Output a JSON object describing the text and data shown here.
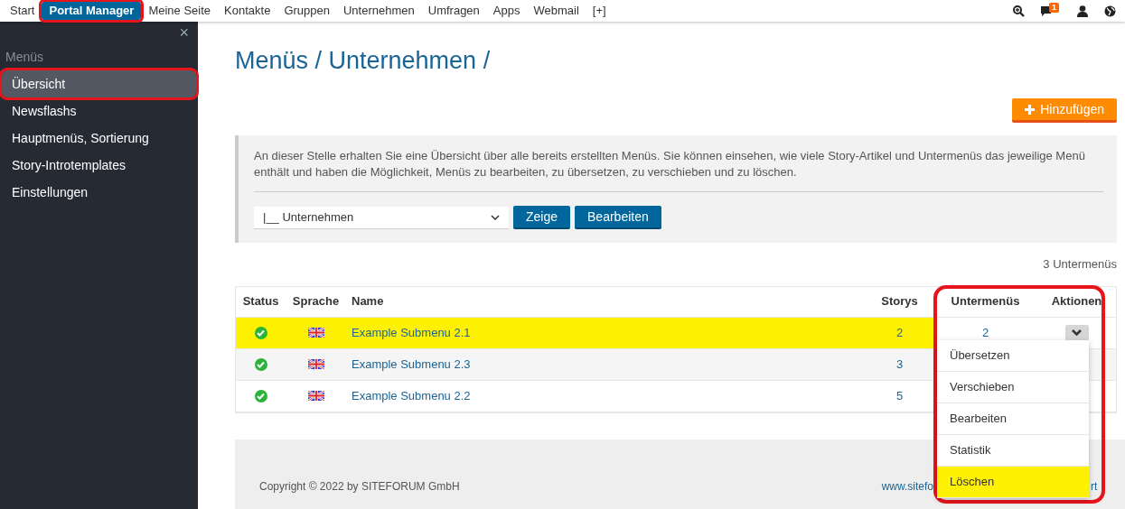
{
  "top_nav": {
    "items": [
      {
        "label": "Start",
        "selected": false,
        "highlighted": false
      },
      {
        "label": "Portal Manager",
        "selected": true,
        "highlighted": true
      },
      {
        "label": "Meine Seite",
        "selected": false,
        "highlighted": false
      },
      {
        "label": "Kontakte",
        "selected": false,
        "highlighted": false
      },
      {
        "label": "Gruppen",
        "selected": false,
        "highlighted": false
      },
      {
        "label": "Unternehmen",
        "selected": false,
        "highlighted": false
      },
      {
        "label": "Umfragen",
        "selected": false,
        "highlighted": false
      },
      {
        "label": "Apps",
        "selected": false,
        "highlighted": false
      },
      {
        "label": "Webmail",
        "selected": false,
        "highlighted": false
      },
      {
        "label": "[+]",
        "selected": false,
        "highlighted": false
      }
    ],
    "message_badge": "1"
  },
  "sidebar": {
    "close": "×",
    "heading": "Menüs",
    "items": [
      {
        "label": "Übersicht",
        "selected": true,
        "highlighted": true
      },
      {
        "label": "Newsflashs",
        "selected": false,
        "highlighted": false
      },
      {
        "label": "Hauptmenüs, Sortierung",
        "selected": false,
        "highlighted": false
      },
      {
        "label": "Story-Introtemplates",
        "selected": false,
        "highlighted": false
      },
      {
        "label": "Einstellungen",
        "selected": false,
        "highlighted": false
      }
    ]
  },
  "breadcrumb": "Menüs / Unternehmen /",
  "add_button": "Hinzufügen",
  "info": {
    "text": "An dieser Stelle erhalten Sie eine Übersicht über alle bereits erstellten Menüs. Sie können einsehen, wie viele Story-Artikel und Untermenüs das jeweilige Menü enthält und haben die Möglichkeit, Menüs zu bearbeiten, zu übersetzen, zu verschieben und zu löschen.",
    "select_value": "|__ Unternehmen",
    "buttons": [
      "Zeige",
      "Bearbeiten"
    ]
  },
  "count": "3 Untermenüs",
  "table": {
    "columns": [
      "Status",
      "Sprache",
      "Name",
      "Storys",
      "Untermenüs",
      "Aktionen"
    ],
    "rows": [
      {
        "name": "Example Submenu 2.1",
        "storys": "2",
        "submenus": "2",
        "selected": true,
        "active": true
      },
      {
        "name": "Example Submenu 2.3",
        "storys": "3",
        "selected": false,
        "active": true
      },
      {
        "name": "Example Submenu 2.2",
        "storys": "5",
        "selected": false,
        "active": true
      }
    ],
    "highlight_region": true
  },
  "actions_menu": {
    "items": [
      {
        "label": "Übersetzen",
        "selected": false
      },
      {
        "label": "Verschieben",
        "selected": false
      },
      {
        "label": "Bearbeiten",
        "selected": false
      },
      {
        "label": "Statistik",
        "selected": false
      },
      {
        "label": "Löschen",
        "selected": true
      }
    ]
  },
  "footer": {
    "copyright": "Copyright © 2022 by SITEFORUM GmbH",
    "link_left": "www.sitefo",
    "link_right": "rt"
  }
}
